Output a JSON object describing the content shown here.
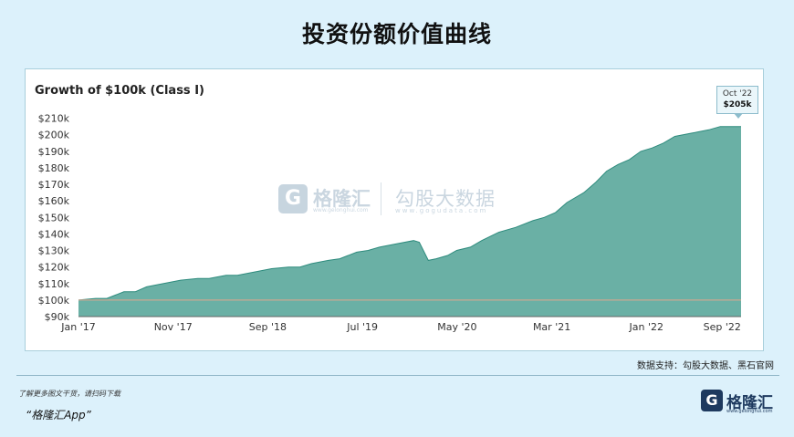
{
  "page": {
    "title": "投资份额价值曲线",
    "source": "数据支持：勾股大数据、黑石官网",
    "promo_line": "了解更多图文干货，请扫码下载",
    "promo_app": "“格隆汇App”"
  },
  "watermark": {
    "brand1": "格隆汇",
    "brand1_sub": "www.gelonghui.com",
    "brand2": "勾股大数据",
    "brand2_sub": "www.gogudata.com"
  },
  "brand": {
    "name": "格隆汇",
    "sub": "www.gelonghui.com"
  },
  "callout": {
    "date": "Oct '22",
    "value": "$205k"
  },
  "colors": {
    "area_fill": "#6ab0a5",
    "area_stroke": "#2e8b7d",
    "baseline": "#c9a892",
    "background": "#dcf1fb"
  },
  "chart_data": {
    "type": "area",
    "title": "Growth of $100k (Class I)",
    "ylim": [
      90,
      212
    ],
    "xlim": [
      2017.0,
      2022.8333
    ],
    "yticks": [
      90,
      100,
      110,
      120,
      130,
      140,
      150,
      160,
      170,
      180,
      190,
      200,
      210
    ],
    "ytick_labels": [
      "$90k",
      "$100k",
      "$110k",
      "$120k",
      "$130k",
      "$140k",
      "$150k",
      "$160k",
      "$170k",
      "$180k",
      "$190k",
      "$200k",
      "$210k"
    ],
    "xticks": [
      {
        "label": "Jan '17",
        "x": 2017.0
      },
      {
        "label": "Nov '17",
        "x": 2017.8333
      },
      {
        "label": "Sep '18",
        "x": 2018.6667
      },
      {
        "label": "Jul '19",
        "x": 2019.5
      },
      {
        "label": "May '20",
        "x": 2020.3333
      },
      {
        "label": "Mar '21",
        "x": 2021.1667
      },
      {
        "label": "Jan '22",
        "x": 2022.0
      },
      {
        "label": "Sep '22",
        "x": 2022.6667
      }
    ],
    "baseline": 100,
    "unit": "$k",
    "series": [
      {
        "x": [
          2017.0,
          2017.15,
          2017.25,
          2017.4,
          2017.5,
          2017.6,
          2017.75,
          2017.9,
          2018.05,
          2018.15,
          2018.3,
          2018.4,
          2018.55,
          2018.7,
          2018.85,
          2018.95,
          2019.05,
          2019.2,
          2019.3,
          2019.45,
          2019.55,
          2019.65,
          2019.8,
          2019.95,
          2020.0,
          2020.08,
          2020.15,
          2020.25,
          2020.33,
          2020.45,
          2020.55,
          2020.7,
          2020.85,
          2021.0,
          2021.1,
          2021.2,
          2021.3,
          2021.45,
          2021.55,
          2021.65,
          2021.75,
          2021.85,
          2021.95,
          2022.05,
          2022.15,
          2022.25,
          2022.4,
          2022.55,
          2022.65,
          2022.7,
          2022.8333
        ],
        "y": [
          100,
          101,
          101,
          105,
          105,
          108,
          110,
          112,
          113,
          113,
          115,
          115,
          117,
          119,
          120,
          120,
          122,
          124,
          125,
          129,
          130,
          132,
          134,
          136,
          135,
          124,
          125,
          127,
          130,
          132,
          136,
          141,
          144,
          148,
          150,
          153,
          159,
          165,
          171,
          178,
          182,
          185,
          190,
          192,
          195,
          199,
          201,
          203,
          205,
          205,
          205
        ]
      }
    ]
  }
}
